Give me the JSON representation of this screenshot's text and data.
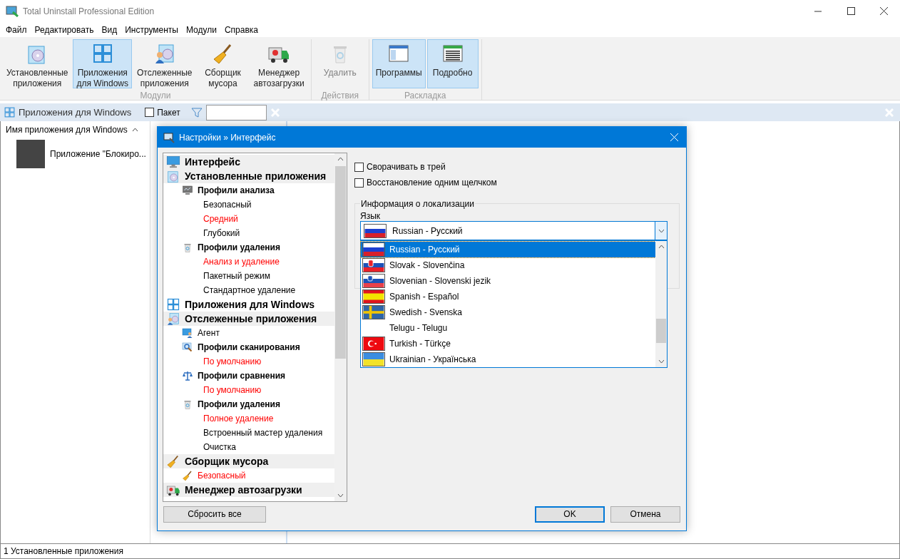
{
  "window": {
    "title": "Total Uninstall Professional Edition"
  },
  "menu": [
    "Файл",
    "Редактировать",
    "Вид",
    "Инструменты",
    "Модули",
    "Справка"
  ],
  "ribbon": {
    "groups": [
      {
        "label": "Модули",
        "buttons": [
          {
            "label": "Установленные\nприложения",
            "kind": "disc",
            "selected": false,
            "disabled": false
          },
          {
            "label": "Приложения\nдля Windows",
            "kind": "apps",
            "selected": true,
            "disabled": false
          },
          {
            "label": "Отслеженные\nприложения",
            "kind": "tracked",
            "selected": false,
            "disabled": false
          },
          {
            "label": "Сборщик\nмусора",
            "kind": "broom",
            "selected": false,
            "disabled": false
          },
          {
            "label": "Менеджер\nавтозагрузки",
            "kind": "truck",
            "selected": false,
            "disabled": false
          }
        ]
      },
      {
        "label": "Действия",
        "buttons": [
          {
            "label": "Удалить",
            "kind": "bin",
            "selected": false,
            "disabled": true
          }
        ]
      },
      {
        "label": "Раскладка",
        "buttons": [
          {
            "label": "Программы",
            "kind": "window",
            "selected": true,
            "disabled": false
          },
          {
            "label": "Подробно",
            "kind": "details",
            "selected": true,
            "disabled": false
          }
        ]
      }
    ]
  },
  "toolbar": {
    "title": "Приложения для Windows",
    "batch": {
      "label": "Пакет",
      "checked": false
    }
  },
  "list": {
    "column": "Имя приложения для Windows",
    "rows": [
      "Приложение \"Блокиро..."
    ]
  },
  "status_bar": "1 Установленные приложения",
  "dialog": {
    "title": "Настройки » Интерфейс",
    "tree": [
      {
        "label": "Интерфейс",
        "kind": "monitor",
        "shaded": true
      },
      {
        "label": "Установленные приложения",
        "kind": "disc",
        "shaded": true,
        "children": [
          {
            "label": "Профили анализа",
            "kind": "analyze",
            "children": [
              {
                "label": "Безопасный",
                "active": false
              },
              {
                "label": "Средний",
                "active": true
              },
              {
                "label": "Глубокий",
                "active": false
              }
            ]
          },
          {
            "label": "Профили удаления",
            "kind": "bin",
            "children": [
              {
                "label": "Анализ и удаление",
                "active": true
              },
              {
                "label": "Пакетный режим",
                "active": false
              },
              {
                "label": "Стандартное удаление",
                "active": false
              }
            ]
          }
        ]
      },
      {
        "label": "Приложения для Windows",
        "kind": "apps",
        "shaded": false
      },
      {
        "label": "Отслеженные приложения",
        "kind": "tracked",
        "shaded": true,
        "children": [
          {
            "label": "Агент",
            "kind": "agent",
            "active": false
          },
          {
            "label": "Профили сканирования",
            "kind": "scan",
            "children": [
              {
                "label": "По умолчанию",
                "active": true
              }
            ]
          },
          {
            "label": "Профили сравнения",
            "kind": "scales",
            "children": [
              {
                "label": "По умолчанию",
                "active": true
              }
            ]
          },
          {
            "label": "Профили удаления",
            "kind": "bin",
            "children": [
              {
                "label": "Полное удаление",
                "active": true
              },
              {
                "label": "Встроенный мастер удаления",
                "active": false
              },
              {
                "label": "Очистка",
                "active": false
              }
            ]
          }
        ]
      },
      {
        "label": "Сборщик мусора",
        "kind": "broom",
        "shaded": true,
        "children": [
          {
            "label": "Безопасный",
            "kind": "broom",
            "active": true
          }
        ]
      },
      {
        "label": "Менеджер автозагрузки",
        "kind": "truck",
        "shaded": true
      }
    ],
    "checkboxes": [
      {
        "label": "Сворачивать в трей",
        "checked": false
      },
      {
        "label": "Восстановление одним щелчком",
        "checked": false
      }
    ],
    "locale": {
      "legend": "Информация о локализации",
      "label": "Язык",
      "value": {
        "label": "Russian - Русский",
        "kind": "russia"
      },
      "options": [
        {
          "label": "Russian - Русский",
          "kind": "russia",
          "selected": true
        },
        {
          "label": "Slovak - Slovenčina",
          "kind": "slovakia",
          "selected": false
        },
        {
          "label": "Slovenian - Slovenski jezik",
          "kind": "slovenia",
          "selected": false
        },
        {
          "label": "Spanish - Español",
          "kind": "spain",
          "selected": false
        },
        {
          "label": "Swedish - Svenska",
          "kind": "sweden",
          "selected": false
        },
        {
          "label": "Telugu - Telugu",
          "kind": "none",
          "selected": false
        },
        {
          "label": "Turkish - Türkçe",
          "kind": "turkey",
          "selected": false
        },
        {
          "label": "Ukrainian - Українська",
          "kind": "ukraine",
          "selected": false
        }
      ]
    },
    "buttons": [
      {
        "label": "Сбросить все",
        "default": false
      },
      {
        "label": "OK",
        "default": true
      },
      {
        "label": "Отмена",
        "default": false
      }
    ]
  }
}
